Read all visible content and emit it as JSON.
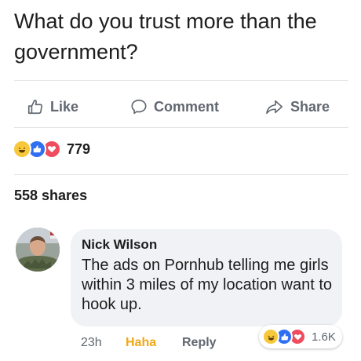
{
  "post": {
    "text": "What do you trust more than the government?"
  },
  "actions": {
    "like_label": "Like",
    "comment_label": "Comment",
    "share_label": "Share"
  },
  "reactions": {
    "count": "779",
    "types": [
      "haha",
      "like",
      "love"
    ]
  },
  "shares": {
    "label": "558 shares"
  },
  "comment": {
    "author": "Nick Wilson",
    "text": "The ads on Pornhub telling me girls within 3 miles of my location want to hook up.",
    "time": "23h",
    "reaction_label": "Haha",
    "reply_label": "Reply",
    "reaction_count": "1.6K",
    "reaction_types": [
      "haha",
      "like",
      "love"
    ]
  },
  "colors": {
    "haha": "#f7c83b",
    "like": "#2f6ff2",
    "love": "#ef4c5e",
    "action_gray": "#616770",
    "haha_text": "#f3a712"
  },
  "icons": {
    "like": "thumbs-up-icon",
    "comment": "speech-bubble-icon",
    "share": "share-arrow-icon"
  }
}
